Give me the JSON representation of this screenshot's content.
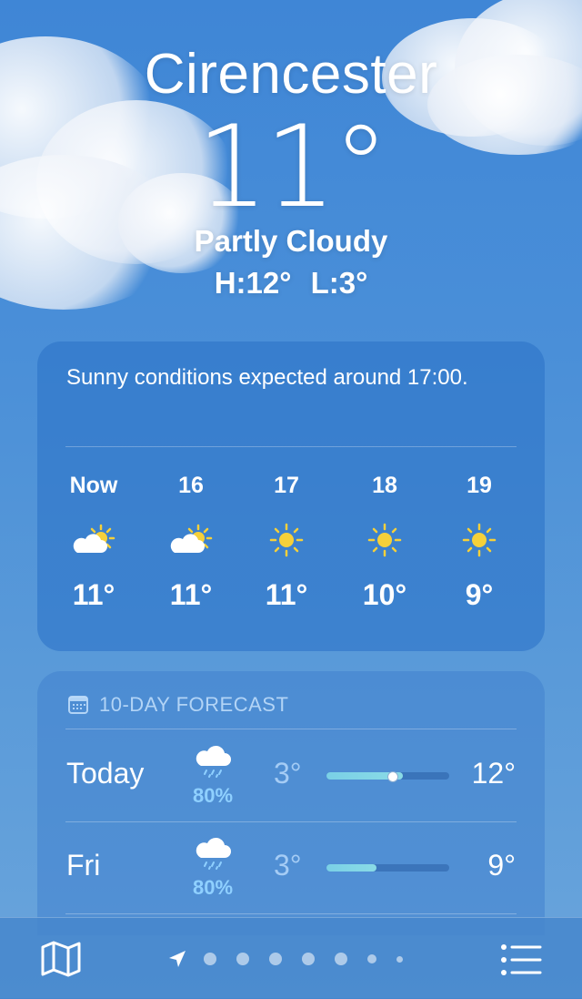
{
  "location": {
    "city": "Cirencester",
    "temperature": "11°",
    "condition": "Partly Cloudy",
    "high": "H:12°",
    "low": "L:3°"
  },
  "hourly": {
    "summary": "Sunny conditions expected around 17:00.",
    "hours": [
      {
        "label": "Now",
        "icon": "partly-cloudy-icon",
        "temp": "11°"
      },
      {
        "label": "16",
        "icon": "partly-cloudy-icon",
        "temp": "11°"
      },
      {
        "label": "17",
        "icon": "sun-icon",
        "temp": "11°"
      },
      {
        "label": "18",
        "icon": "sun-icon",
        "temp": "10°"
      },
      {
        "label": "19",
        "icon": "sun-icon",
        "temp": "9°"
      }
    ]
  },
  "forecast": {
    "title": "10-DAY FORECAST",
    "days": [
      {
        "day": "Today",
        "icon": "rain-cloud-icon",
        "precip": "80%",
        "low": "3°",
        "high": "12°",
        "range_start": 0.0,
        "range_end": 0.62,
        "current": 0.53
      },
      {
        "day": "Fri",
        "icon": "rain-cloud-icon",
        "precip": "80%",
        "low": "3°",
        "high": "9°",
        "range_start": 0.0,
        "range_end": 0.41
      }
    ]
  },
  "tabbar": {
    "map_icon": "map-icon",
    "list_icon": "list-icon",
    "pages": 7,
    "current_page": 0
  },
  "colors": {
    "sky": "#4a8fd8",
    "sun": "#f5d03a",
    "precip": "#8fd0ff",
    "range_bar": "#7ad0e6"
  }
}
